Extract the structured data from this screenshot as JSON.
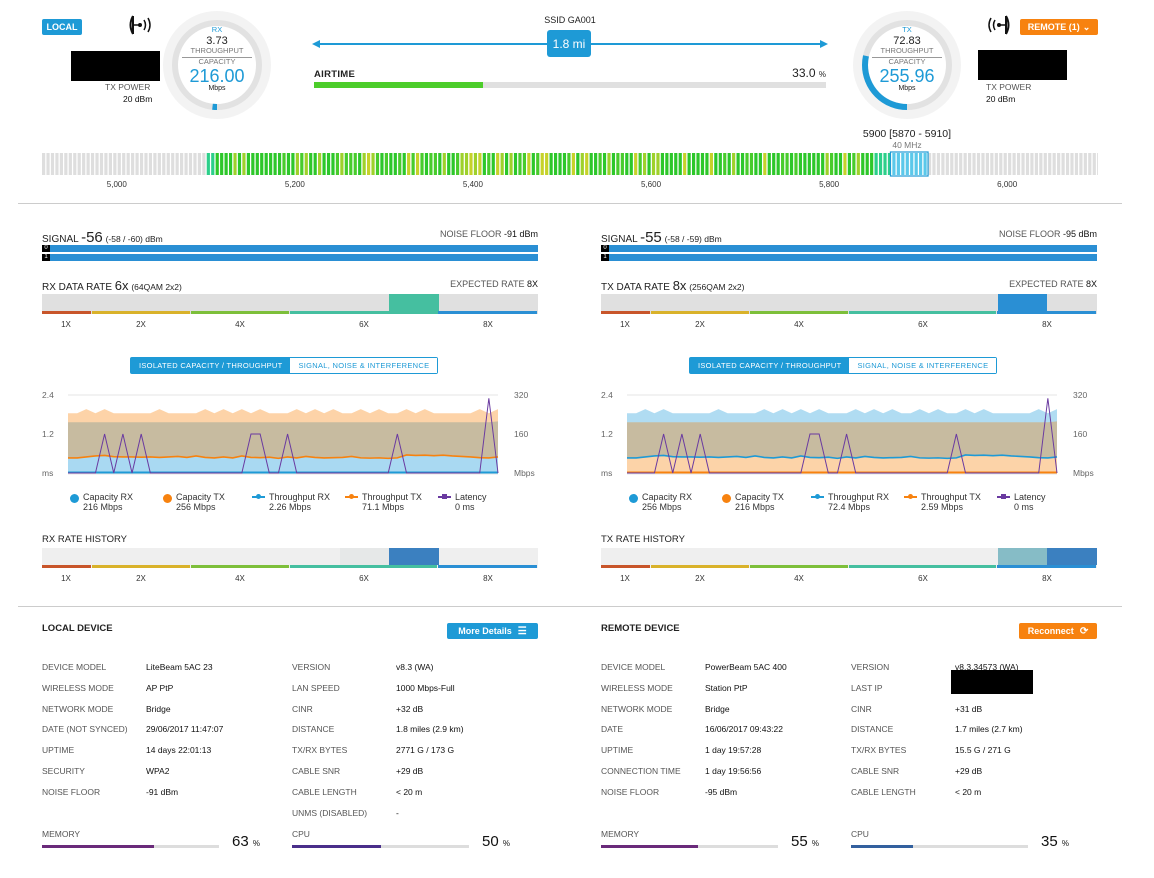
{
  "colors": {
    "accent": "#1e9ad6",
    "remote": "#f7820f",
    "airtime": "#4ccd2a",
    "memory": "#6a2a7a",
    "cpu_local": "#4a2f8a",
    "cpu_remote": "#33609e"
  },
  "header": {
    "local_badge": "LOCAL",
    "remote_badge": "REMOTE (1)",
    "ssid": "SSID GA001",
    "distance": "1.8 mi",
    "airtime_label": "AIRTIME",
    "airtime_value": "33.0",
    "airtime_unit": "%",
    "airtime_percent": 33.0,
    "local": {
      "tx_power_label": "TX POWER",
      "tx_power": "20 dBm",
      "gauge": {
        "dir": "RX",
        "throughput": "3.73",
        "throughput_label": "THROUGHPUT",
        "capacity_label": "CAPACITY",
        "capacity": "216.00",
        "unit": "Mbps"
      }
    },
    "remote": {
      "tx_power_label": "TX POWER",
      "tx_power": "20 dBm",
      "gauge": {
        "dir": "TX",
        "throughput": "72.83",
        "throughput_label": "THROUGHPUT",
        "capacity_label": "CAPACITY",
        "capacity": "255.96",
        "unit": "Mbps"
      }
    }
  },
  "spectrum": {
    "channel": "5900 [5870 - 5910]",
    "width": "40 MHz",
    "range_mhz": [
      4916,
      6102
    ],
    "active_range_mhz": [
      5100,
      5870
    ],
    "selected_mhz": [
      5870,
      5910
    ],
    "ticks": [
      "5,000",
      "5,200",
      "5,400",
      "5,600",
      "5,800",
      "6,000"
    ],
    "tick_values": [
      5000,
      5200,
      5400,
      5600,
      5800,
      6000
    ]
  },
  "panels": {
    "local": {
      "signal_label": "SIGNAL",
      "signal": "-56",
      "signal_chains": "(-58 / -60) dBm",
      "noise_label": "NOISE FLOOR",
      "noise": "-91 dBm",
      "chains": [
        "0",
        "1"
      ],
      "rate_label": "RX DATA RATE",
      "rate": "6x",
      "rate_mod": "(64QAM 2x2)",
      "expected_label": "EXPECTED RATE",
      "expected": "8X",
      "rate_labels": [
        "1X",
        "2X",
        "4X",
        "6X",
        "8X"
      ],
      "rate_slot_levels": [
        0,
        0,
        0,
        0,
        0,
        0,
        0,
        1,
        0,
        0
      ],
      "tabs": [
        "ISOLATED CAPACITY / THROUGHPUT",
        "SIGNAL, NOISE & INTERFERENCE"
      ],
      "history_label": "RX RATE HISTORY",
      "history_levels": [
        0,
        0,
        0,
        0,
        0,
        0,
        0.1,
        1,
        0,
        0
      ]
    },
    "remote": {
      "signal_label": "SIGNAL",
      "signal": "-55",
      "signal_chains": "(-58 / -59) dBm",
      "noise_label": "NOISE FLOOR",
      "noise": "-95 dBm",
      "chains": [
        "0",
        "1"
      ],
      "rate_label": "TX DATA RATE",
      "rate": "8x",
      "rate_mod": "(256QAM 2x2)",
      "expected_label": "EXPECTED RATE",
      "expected": "8X",
      "rate_labels": [
        "1X",
        "2X",
        "4X",
        "6X",
        "8X"
      ],
      "rate_slot_levels": [
        0,
        0,
        0,
        0,
        0,
        0,
        0,
        0,
        1,
        0
      ],
      "tabs": [
        "ISOLATED CAPACITY / THROUGHPUT",
        "SIGNAL, NOISE & INTERFERENCE"
      ],
      "history_label": "TX RATE HISTORY",
      "history_levels": [
        0,
        0,
        0,
        0,
        0,
        0,
        0,
        0,
        0.5,
        1
      ]
    }
  },
  "chart_data": [
    {
      "type": "area",
      "left_axis": {
        "ticks": [
          "2.4",
          "1.2",
          "ms"
        ],
        "range": [
          0,
          2.4
        ]
      },
      "right_axis": {
        "ticks": [
          "320",
          "160",
          "Mbps"
        ],
        "range": [
          0,
          320
        ]
      },
      "legend": [
        {
          "name": "Capacity RX",
          "value": "216 Mbps",
          "color": "#1e9ad6"
        },
        {
          "name": "Capacity TX",
          "value": "256 Mbps",
          "color": "#f7820f"
        },
        {
          "name": "Throughput RX",
          "value": "2.26 Mbps",
          "color": "#1e9ad6"
        },
        {
          "name": "Throughput TX",
          "value": "71.1 Mbps",
          "color": "#f7820f"
        },
        {
          "name": "Latency",
          "value": "0 ms",
          "color": "#6a3aa0"
        }
      ],
      "series": {
        "capacity_tx": [
          245,
          245,
          262,
          245,
          262,
          245,
          245,
          245,
          245,
          245,
          262,
          245,
          245,
          245,
          245,
          262,
          245,
          262,
          245,
          262,
          245,
          262,
          245,
          245,
          245,
          262,
          245,
          262,
          245,
          262,
          245,
          245,
          262,
          245,
          262,
          245,
          245,
          262,
          245,
          262,
          245,
          245,
          245,
          245,
          245,
          262,
          245,
          262
        ],
        "capacity_rx": [
          208,
          208,
          208,
          208,
          208,
          208,
          208,
          208,
          208,
          208,
          208,
          208,
          208,
          208,
          208,
          208,
          208,
          208,
          208,
          208,
          208,
          208,
          208,
          208,
          208,
          208,
          208,
          208,
          208,
          208,
          208,
          208,
          208,
          208,
          208,
          208,
          208,
          208,
          208,
          208,
          208,
          208,
          208,
          208,
          208,
          208,
          208,
          212
        ],
        "throughput_tx": [
          62,
          62,
          66,
          70,
          72,
          67,
          66,
          66,
          65,
          66,
          64,
          66,
          68,
          64,
          70,
          64,
          62,
          66,
          62,
          70,
          64,
          63,
          65,
          60,
          66,
          62,
          68,
          64,
          62,
          63,
          64,
          68,
          62,
          61,
          62,
          60,
          62,
          74,
          72,
          73,
          71,
          73,
          70,
          68,
          66,
          63,
          62,
          66
        ],
        "throughput_rx": [
          2,
          2,
          2,
          2,
          2,
          2,
          2,
          2,
          2,
          2,
          2,
          2,
          2,
          2,
          2,
          2,
          2,
          2,
          2,
          2,
          2,
          2,
          2,
          2,
          2,
          2,
          2,
          2,
          2,
          2,
          2,
          2,
          2,
          2,
          2,
          2,
          2,
          2,
          2,
          2,
          2,
          2,
          2,
          2,
          2,
          2,
          2,
          2
        ],
        "latency": [
          0,
          0,
          0,
          0,
          1.2,
          0,
          1.2,
          0,
          1.2,
          0,
          0,
          0,
          0,
          0,
          0,
          0,
          0,
          0,
          0,
          0,
          1.2,
          1.2,
          0,
          0,
          1.2,
          0,
          0,
          0,
          0,
          0,
          0,
          0,
          0,
          0,
          0,
          0,
          1.2,
          0,
          0,
          0,
          0,
          0,
          0,
          0,
          0,
          0,
          2.3,
          0
        ]
      }
    },
    {
      "type": "area",
      "left_axis": {
        "ticks": [
          "2.4",
          "1.2",
          "ms"
        ],
        "range": [
          0,
          2.4
        ]
      },
      "right_axis": {
        "ticks": [
          "320",
          "160",
          "Mbps"
        ],
        "range": [
          0,
          320
        ]
      },
      "legend": [
        {
          "name": "Capacity RX",
          "value": "256 Mbps",
          "color": "#1e9ad6"
        },
        {
          "name": "Capacity TX",
          "value": "216 Mbps",
          "color": "#f7820f"
        },
        {
          "name": "Throughput RX",
          "value": "72.4 Mbps",
          "color": "#1e9ad6"
        },
        {
          "name": "Throughput TX",
          "value": "2.59 Mbps",
          "color": "#f7820f"
        },
        {
          "name": "Latency",
          "value": "0 ms",
          "color": "#6a3aa0"
        }
      ],
      "series": {
        "capacity_rx": [
          245,
          245,
          262,
          245,
          262,
          245,
          245,
          245,
          245,
          245,
          262,
          245,
          245,
          245,
          245,
          262,
          245,
          262,
          245,
          262,
          245,
          262,
          245,
          245,
          245,
          262,
          245,
          262,
          245,
          262,
          245,
          245,
          262,
          245,
          262,
          245,
          245,
          262,
          245,
          262,
          245,
          245,
          245,
          245,
          245,
          262,
          245,
          262
        ],
        "capacity_tx": [
          208,
          208,
          208,
          208,
          208,
          208,
          208,
          208,
          208,
          208,
          208,
          208,
          208,
          208,
          208,
          208,
          208,
          208,
          208,
          208,
          208,
          208,
          208,
          208,
          208,
          208,
          208,
          208,
          208,
          208,
          208,
          208,
          208,
          208,
          208,
          208,
          208,
          208,
          208,
          208,
          208,
          208,
          208,
          208,
          208,
          208,
          208,
          212
        ],
        "throughput_rx": [
          62,
          62,
          66,
          70,
          72,
          67,
          66,
          66,
          65,
          66,
          64,
          66,
          68,
          64,
          70,
          64,
          62,
          66,
          62,
          70,
          64,
          63,
          65,
          60,
          66,
          62,
          68,
          64,
          62,
          63,
          64,
          68,
          62,
          61,
          62,
          60,
          62,
          74,
          72,
          73,
          71,
          73,
          70,
          68,
          66,
          63,
          62,
          66
        ],
        "throughput_tx": [
          2,
          2,
          2,
          2,
          2,
          2,
          2,
          2,
          2,
          2,
          2,
          2,
          2,
          2,
          2,
          2,
          2,
          2,
          2,
          2,
          2,
          2,
          2,
          2,
          2,
          2,
          2,
          2,
          2,
          2,
          2,
          2,
          2,
          2,
          2,
          2,
          2,
          2,
          2,
          2,
          2,
          2,
          2,
          2,
          2,
          2,
          2,
          2
        ],
        "latency": [
          0,
          0,
          0,
          0,
          1.2,
          0,
          1.2,
          0,
          1.2,
          0,
          0,
          0,
          0,
          0,
          0,
          0,
          0,
          0,
          0,
          0,
          1.2,
          1.2,
          0,
          0,
          1.2,
          0,
          0,
          0,
          0,
          0,
          0,
          0,
          0,
          0,
          0,
          0,
          1.2,
          0,
          0,
          0,
          0,
          0,
          0,
          0,
          0,
          0,
          2.3,
          0
        ]
      }
    }
  ],
  "devices": {
    "local": {
      "title": "LOCAL DEVICE",
      "button": "More Details",
      "left": [
        [
          "DEVICE MODEL",
          "LiteBeam 5AC 23"
        ],
        [
          "WIRELESS MODE",
          "AP PtP"
        ],
        [
          "NETWORK MODE",
          "Bridge"
        ],
        [
          "DATE (NOT SYNCED)",
          "29/06/2017 11:47:07"
        ],
        [
          "UPTIME",
          "14 days 22:01:13"
        ],
        [
          "SECURITY",
          "WPA2"
        ],
        [
          "NOISE FLOOR",
          "-91 dBm"
        ]
      ],
      "right": [
        [
          "VERSION",
          "v8.3 (WA)"
        ],
        [
          "LAN SPEED",
          "1000 Mbps-Full"
        ],
        [
          "CINR",
          "+32 dB"
        ],
        [
          "DISTANCE",
          "1.8 miles (2.9 km)"
        ],
        [
          "TX/RX BYTES",
          "2771 G / 173 G"
        ],
        [
          "CABLE SNR",
          "+29 dB"
        ],
        [
          "CABLE LENGTH",
          "< 20 m"
        ],
        [
          "UNMS (DISABLED)",
          "-"
        ]
      ],
      "memory_label": "MEMORY",
      "memory": "63",
      "memory_percent": 63,
      "cpu_label": "CPU",
      "cpu": "50",
      "cpu_percent": 50,
      "unit": "%"
    },
    "remote": {
      "title": "REMOTE DEVICE",
      "button": "Reconnect",
      "left": [
        [
          "DEVICE MODEL",
          "PowerBeam 5AC 400"
        ],
        [
          "WIRELESS MODE",
          "Station PtP"
        ],
        [
          "NETWORK MODE",
          "Bridge"
        ],
        [
          "DATE",
          "16/06/2017 09:43:22"
        ],
        [
          "UPTIME",
          "1 day 19:57:28"
        ],
        [
          "CONNECTION TIME",
          "1 day 19:56:56"
        ],
        [
          "NOISE FLOOR",
          "-95 dBm"
        ]
      ],
      "right": [
        [
          "VERSION",
          "v8.3.34573 (WA)"
        ],
        [
          "LAST IP",
          ""
        ],
        [
          "CINR",
          "+31 dB"
        ],
        [
          "DISTANCE",
          "1.7 miles (2.7 km)"
        ],
        [
          "TX/RX BYTES",
          "15.5 G / 271 G"
        ],
        [
          "CABLE SNR",
          "+29 dB"
        ],
        [
          "CABLE LENGTH",
          "< 20 m"
        ]
      ],
      "memory_label": "MEMORY",
      "memory": "55",
      "memory_percent": 55,
      "cpu_label": "CPU",
      "cpu": "35",
      "cpu_percent": 35,
      "unit": "%"
    }
  }
}
